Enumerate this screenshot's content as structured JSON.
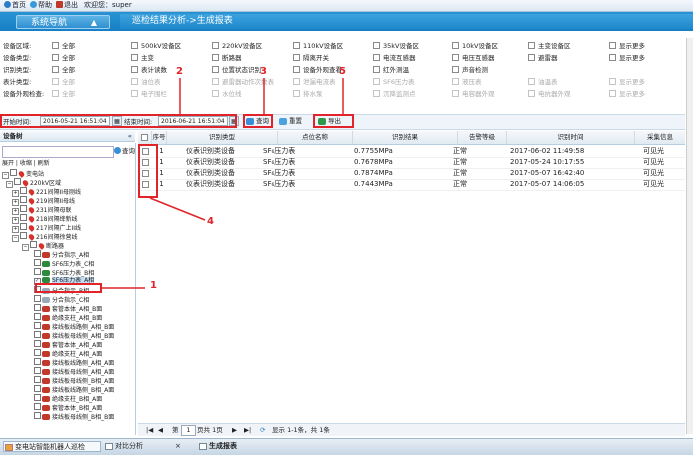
{
  "topbar": {
    "home": "首页",
    "help": "帮助",
    "exit": "退出",
    "welcome": "欢迎您：super"
  },
  "nav": {
    "title": "系统导航",
    "arrow": "▲",
    "breadcrumb": "巡检结果分析->生成报表"
  },
  "filters": {
    "rows": [
      {
        "label": "设备区域:",
        "options": [
          "全部",
          "500kV设备区",
          "220kV设备区",
          "110kV设备区",
          "35kV设备区",
          "10kV设备区",
          "主变设备区",
          "显示更多"
        ]
      },
      {
        "label": "设备类型:",
        "options": [
          "全部",
          "主变",
          "断路器",
          "隔离开关",
          "电流互感器",
          "电压互感器",
          "避雷器",
          "显示更多"
        ]
      },
      {
        "label": "识别类型:",
        "options": [
          "全部",
          "表计读数",
          "位置状态识别",
          "设备外观查看",
          "红外测温",
          "声音检测"
        ]
      },
      {
        "label": "表计类型:",
        "options": [
          "全部",
          "油位表",
          "避雷器动作次数表",
          "泄漏电流表",
          "SF6压力表",
          "液压表",
          "油温表",
          "显示更多"
        ]
      },
      {
        "label": "设备外观检查:",
        "options": [
          "全部",
          "电子围栏",
          "水位线",
          "排水泵",
          "沉降监测点",
          "电容器外观",
          "电抗器外观",
          "显示更多"
        ]
      }
    ]
  },
  "timebar": {
    "start_label": "开始时间:",
    "start_value": "2016-05-21 16:51:04",
    "end_label": "结束时间:",
    "end_value": "2016-06-21 16:51:04",
    "query": "查询",
    "reset": "重置",
    "export": "导出"
  },
  "tree": {
    "title": "设备树",
    "collapse": "«",
    "query": "查询",
    "actions": "展开 | 收缩 | 刷新",
    "nodes": [
      "变电站",
      "220kV区域",
      "221间隔II母刚线",
      "219间隔II母线",
      "231间隔母联",
      "218间隔绛新线",
      "217间隔广上II线",
      "216间隔徐营线",
      "断路器",
      "分合指示_A相",
      "SF6压力表_C相",
      "SF6压力表_B相",
      "SF6压力表_A相",
      "分合指示_B相",
      "分合指示_C相",
      "套管本体_A相_B面",
      "绝缘支柱_A相_B面",
      "接线板线路侧_A相_B面",
      "接线板母线侧_A相_B面",
      "套管本体_A相_A面",
      "绝缘支柱_A相_A面",
      "接线板线路侧_A相_A面",
      "接线板母线侧_A相_A面",
      "接线板母线侧_B相_A面",
      "接线板线路侧_B相_A面",
      "绝缘支柱_B相_A面",
      "套管本体_B相_A面",
      "接线板母线侧_B相_B面"
    ]
  },
  "table": {
    "headers": [
      "序号",
      "识别类型",
      "点位名称",
      "识别结果",
      "告警等级",
      "识别时间",
      "采集信息"
    ],
    "rows": [
      {
        "no": "1",
        "type": "仪表识别类设备",
        "point": "SF₆压力表",
        "result": "0.7755MPa",
        "level": "正常",
        "time": "2017-06-02 11:49:58",
        "info": "可见光"
      },
      {
        "no": "1",
        "type": "仪表识别类设备",
        "point": "SF₆压力表",
        "result": "0.7678MPa",
        "level": "正常",
        "time": "2017-05-24 10:17:55",
        "info": "可见光"
      },
      {
        "no": "1",
        "type": "仪表识别类设备",
        "point": "SF₆压力表",
        "result": "0.7874MPa",
        "level": "正常",
        "time": "2017-05-07 16:42:40",
        "info": "可见光"
      },
      {
        "no": "1",
        "type": "仪表识别类设备",
        "point": "SF₆压力表",
        "result": "0.7443MPa",
        "level": "正常",
        "time": "2017-05-07 14:06:05",
        "info": "可见光"
      }
    ]
  },
  "pager": {
    "first": "|◀",
    "prev": "◀",
    "page_prefix": "第",
    "page_value": "1",
    "page_suffix": "页共 1页",
    "next": "▶",
    "last": "▶|",
    "summary": "显示 1-1条，共 1条"
  },
  "annotations": [
    "1",
    "2",
    "3",
    "4",
    "5"
  ],
  "taskbar": {
    "items": [
      "变电站智能机器人巡检",
      "对比分析",
      "生成报表"
    ]
  },
  "colors": {
    "header": "#1e88cb",
    "highlight": "#e0242a"
  }
}
